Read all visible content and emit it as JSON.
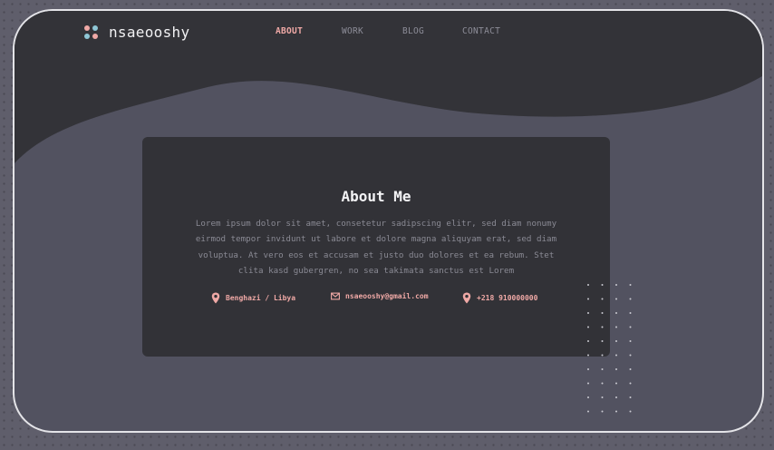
{
  "brand": {
    "name": "nsaeooshy"
  },
  "nav": {
    "items": [
      {
        "label": "ABOUT",
        "active": true
      },
      {
        "label": "WORK",
        "active": false
      },
      {
        "label": "BLOG",
        "active": false
      },
      {
        "label": "CONTACT",
        "active": false
      }
    ]
  },
  "about": {
    "title": "About Me",
    "body": "Lorem ipsum dolor sit amet, consetetur sadipscing elitr, sed diam nonumy eirmod tempor invidunt ut labore et dolore magna aliquyam erat, sed diam voluptua. At vero eos et accusam et justo duo dolores et ea rebum. Stet clita kasd gubergren, no sea takimata sanctus est Lorem"
  },
  "contacts": [
    {
      "icon": "location-pin-icon",
      "text": "Benghazi / Libya"
    },
    {
      "icon": "mail-icon",
      "text": "nsaeooshy@gmail.com"
    },
    {
      "icon": "location-pin-icon",
      "text": "+218 910000000"
    }
  ],
  "colors": {
    "accent": "#f0a9a6",
    "secondary": "#8fc7d6",
    "card": "#323237",
    "frame": "#525260"
  }
}
